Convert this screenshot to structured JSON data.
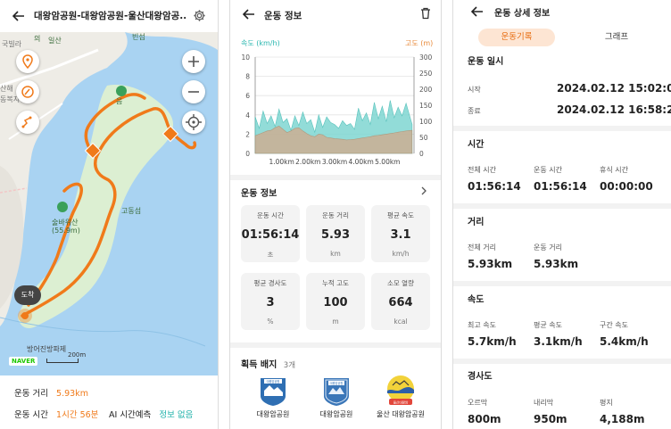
{
  "route": {
    "title": "대왕암공원-대왕암공원-울산대왕암공...",
    "map_labels": {
      "label_a": "의",
      "label_b": "빈섬",
      "label_c": "일산",
      "label_d": "국빌라",
      "label_e": "산해",
      "label_f": "동복지센터",
      "label_g": "음",
      "label_h": "술바위산",
      "label_i": "(55.9m)",
      "label_j": "고동섬",
      "label_k": "도착",
      "label_l": "방어진방파제",
      "label_m": "200m"
    },
    "map_brand": "NAVER",
    "distance_label": "운동 거리",
    "distance_value": "5.93km",
    "time_label": "운동 시간",
    "time_value": "1시간 56분",
    "ai_label": "AI 시간예측",
    "ai_value": "정보 없음"
  },
  "workout": {
    "title": "운동 정보",
    "chart_left_label": "속도 (km/h)",
    "chart_right_label": "고도 (m)",
    "section_title": "운동 정보",
    "cards": [
      {
        "label": "운동 시간",
        "value": "01:56:14",
        "unit": "초"
      },
      {
        "label": "운동 거리",
        "value": "5.93",
        "unit": "km"
      },
      {
        "label": "평균 속도",
        "value": "3.1",
        "unit": "km/h"
      },
      {
        "label": "평균 경사도",
        "value": "3",
        "unit": "%"
      },
      {
        "label": "누적 고도",
        "value": "100",
        "unit": "m"
      },
      {
        "label": "소모 열량",
        "value": "664",
        "unit": "kcal"
      }
    ],
    "badges_title": "획득 배지",
    "badges_count": "3개",
    "badges": [
      {
        "name": "대왕암공원",
        "emblem": "대왕암공원"
      },
      {
        "name": "대왕암공원",
        "emblem": "대왕암공원"
      },
      {
        "name": "울산 대왕암공원",
        "emblem": "울산대왕암"
      }
    ]
  },
  "chart_data": {
    "type": "area",
    "xlabel": "",
    "x_ticks": [
      "1.00km",
      "2.00km",
      "3.00km",
      "4.00km",
      "5.00km"
    ],
    "left_axis": {
      "label": "속도 (km/h)",
      "ticks": [
        0,
        2,
        4,
        6,
        8,
        10
      ],
      "ylim": [
        0,
        10
      ],
      "color": "#2bb7b0"
    },
    "right_axis": {
      "label": "고도 (m)",
      "ticks": [
        0,
        50,
        100,
        150,
        200,
        250,
        300
      ],
      "ylim": [
        0,
        300
      ],
      "color": "#e88a3a"
    },
    "x": [
      0.0,
      0.15,
      0.3,
      0.45,
      0.6,
      0.75,
      0.9,
      1.05,
      1.2,
      1.35,
      1.5,
      1.65,
      1.8,
      1.95,
      2.1,
      2.25,
      2.4,
      2.55,
      2.7,
      2.85,
      3.0,
      3.15,
      3.3,
      3.45,
      3.6,
      3.75,
      3.9,
      4.05,
      4.2,
      4.35,
      4.5,
      4.65,
      4.8,
      4.95,
      5.1,
      5.25,
      5.4,
      5.55,
      5.7,
      5.93
    ],
    "series": [
      {
        "axis": "left",
        "color": "#7fd6d2",
        "values": [
          3.8,
          2.6,
          4.4,
          3.1,
          3.9,
          2.8,
          4.6,
          3.2,
          3.6,
          2.4,
          3.9,
          2.9,
          4.3,
          3.1,
          3.5,
          2.2,
          4.0,
          2.7,
          3.8,
          3.2,
          3.0,
          2.6,
          3.4,
          2.9,
          3.1,
          2.5,
          4.7,
          3.4,
          4.2,
          3.0,
          5.3,
          3.6,
          4.9,
          3.3,
          5.5,
          3.7,
          4.8,
          3.9,
          5.2,
          3.0
        ]
      },
      {
        "axis": "right",
        "color": "#d4a98a",
        "values": [
          55,
          60,
          65,
          70,
          72,
          80,
          85,
          75,
          65,
          70,
          78,
          80,
          70,
          62,
          55,
          52,
          60,
          58,
          50,
          48,
          46,
          45,
          44,
          42,
          43,
          44,
          46,
          48,
          50,
          52,
          55,
          56,
          58,
          60,
          62,
          64,
          66,
          68,
          70,
          72
        ]
      }
    ]
  },
  "detail": {
    "title": "운동 상세 정보",
    "tab_record": "운동기록",
    "tab_graph": "그래프",
    "date_title": "운동 일시",
    "start_label": "시작",
    "start_value": "2024.02.12 15:02:06",
    "end_label": "종료",
    "end_value": "2024.02.12 16:58:20",
    "time_title": "시간",
    "total_time_label": "전체 시간",
    "total_time_value": "01:56:14",
    "moving_time_label": "운동 시간",
    "moving_time_value": "01:56:14",
    "rest_time_label": "휴식 시간",
    "rest_time_value": "00:00:00",
    "distance_title": "거리",
    "total_dist_label": "전체 거리",
    "total_dist_value": "5.93km",
    "moving_dist_label": "운동 거리",
    "moving_dist_value": "5.93km",
    "speed_title": "속도",
    "max_speed_label": "최고 속도",
    "max_speed_value": "5.7km/h",
    "avg_speed_label": "평균 속도",
    "avg_speed_value": "3.1km/h",
    "section_speed_label": "구간 속도",
    "section_speed_value": "5.4km/h",
    "slope_title": "경사도",
    "uphill_label": "오르막",
    "uphill_value": "800m",
    "downhill_label": "내리막",
    "downhill_value": "950m",
    "flat_label": "평지",
    "flat_value": "4,188m"
  }
}
